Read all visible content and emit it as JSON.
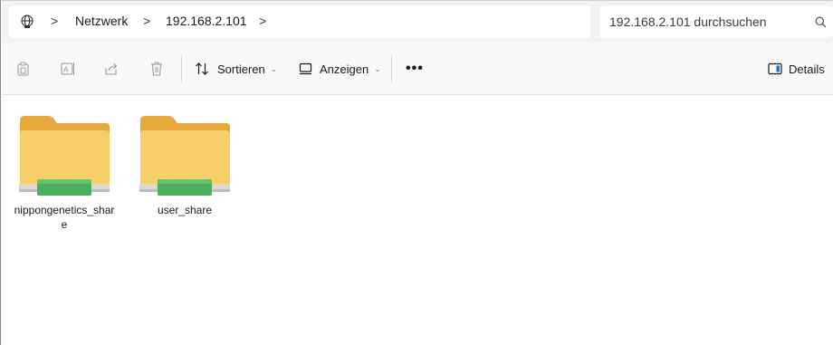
{
  "address_bar": {
    "breadcrumbs": [
      "Netzwerk",
      "192.168.2.101"
    ],
    "separator": ">",
    "globe_icon": "globe-icon"
  },
  "search": {
    "placeholder": "192.168.2.101 durchsuchen",
    "icon": "search-icon"
  },
  "toolbar": {
    "copy_icon": "copy-icon",
    "rename_icon": "rename-icon",
    "share_icon": "share-icon",
    "delete_icon": "trash-icon",
    "sort_label": "Sortieren",
    "view_label": "Anzeigen",
    "more_label": "•••",
    "details_label": "Details"
  },
  "items": [
    {
      "name": "nippongenetics_share",
      "type": "network-share-folder"
    },
    {
      "name": "user_share",
      "type": "network-share-folder"
    }
  ],
  "colors": {
    "folder_back": "#e8a93c",
    "folder_front": "#f6cf68",
    "share_bar": "#4caf5c",
    "toolbar_bg": "#f9f9f9",
    "address_bg": "#f3f3f3"
  }
}
